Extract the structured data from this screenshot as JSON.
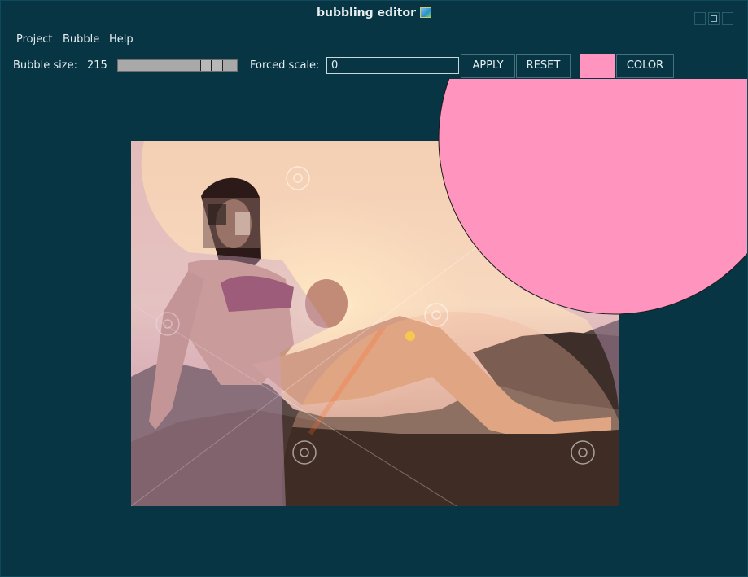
{
  "window": {
    "title": "bubbling editor",
    "title_icon": "picture-icon",
    "controls": [
      "minimize-icon",
      "maximize-icon",
      "close-icon"
    ]
  },
  "menu": [
    "Project",
    "Bubble",
    "Help"
  ],
  "toolbar": {
    "bubble_size_label": "Bubble size:",
    "bubble_size_value": "215",
    "slider_level_fraction": 0.86,
    "forced_scale_label": "Forced scale:",
    "forced_scale_value": "0",
    "apply_label": "APPLY",
    "reset_label": "RESET",
    "color_label": "COLOR"
  },
  "colors": {
    "background": "#073544",
    "bubble": "#ff94bf",
    "swatch": "#ff94bf"
  }
}
